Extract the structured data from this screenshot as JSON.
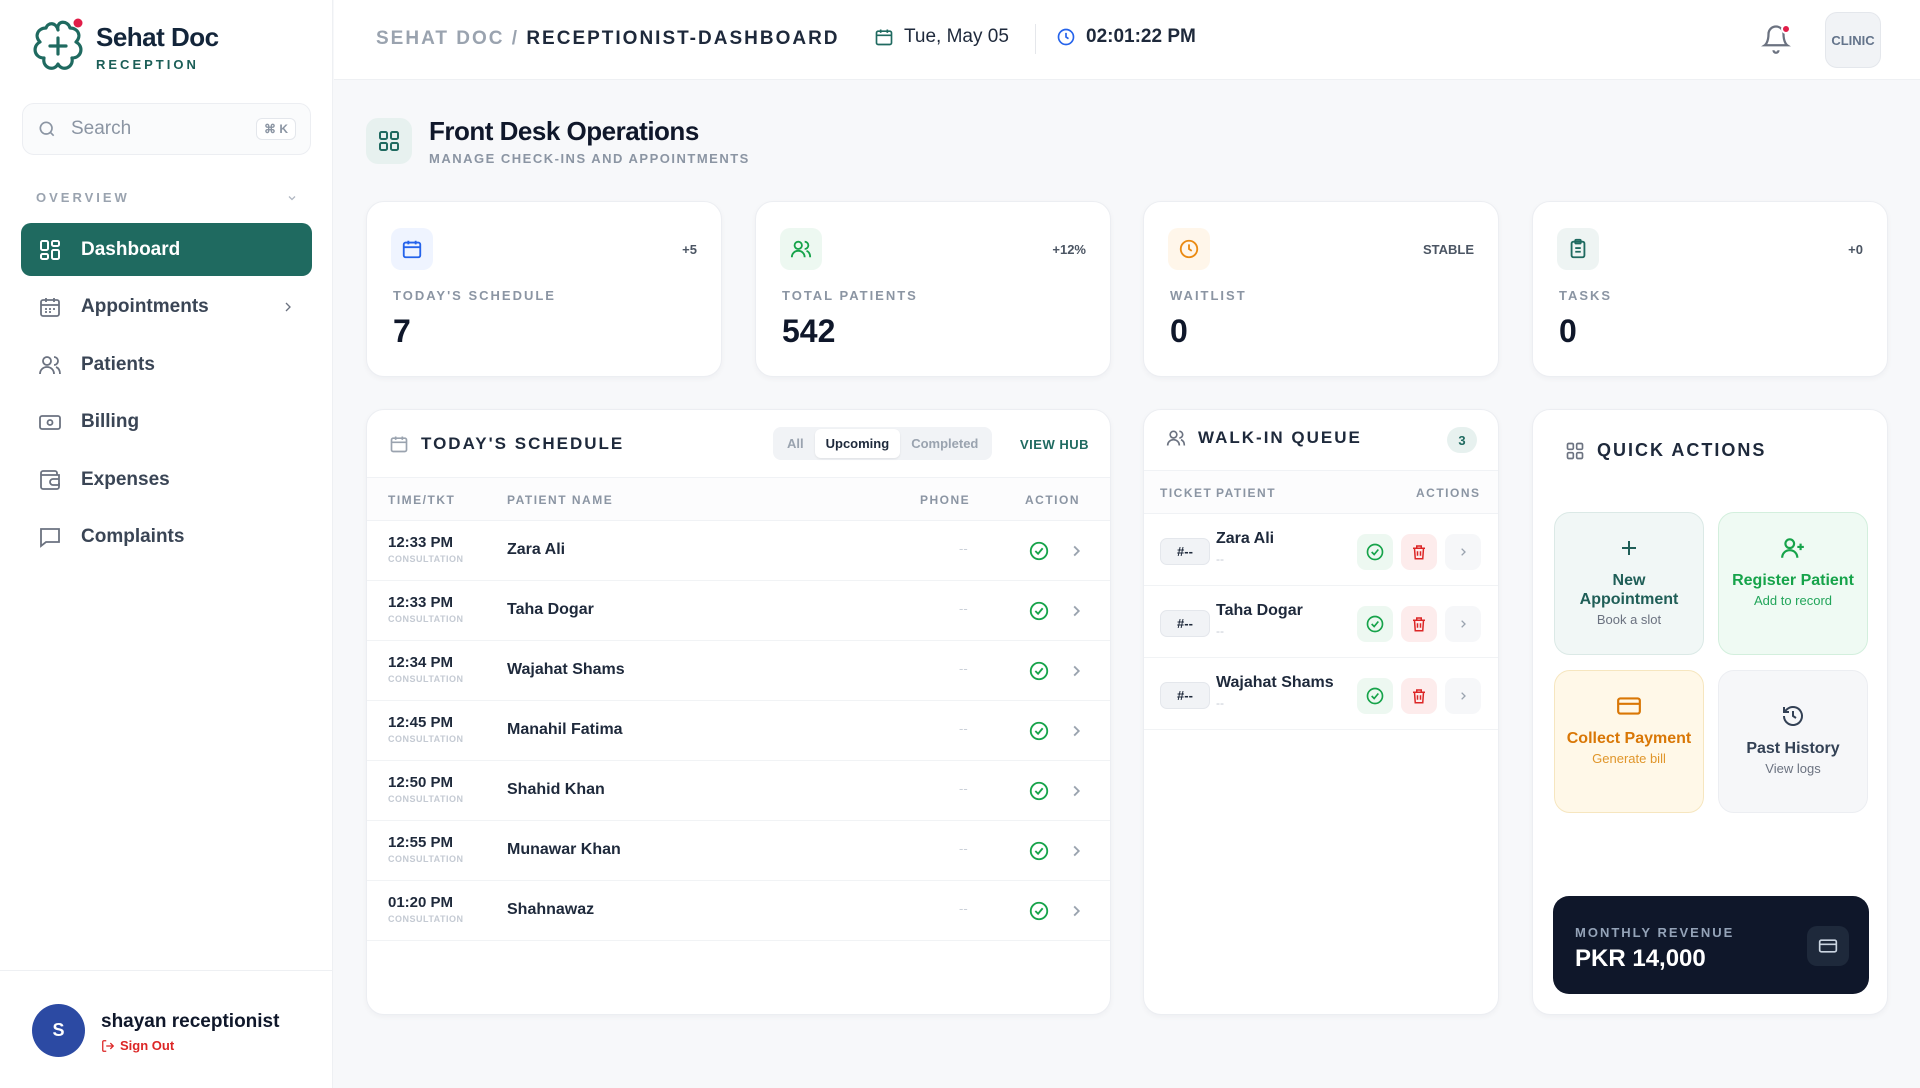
{
  "brand": {
    "name": "Sehat Doc",
    "sub": "RECEPTION"
  },
  "search": {
    "placeholder": "Search",
    "shortcut": "⌘ K"
  },
  "sidebar": {
    "section": "OVERVIEW",
    "items": [
      {
        "label": "Dashboard",
        "icon": "grid-icon",
        "active": true
      },
      {
        "label": "Appointments",
        "icon": "calendar-icon"
      },
      {
        "label": "Patients",
        "icon": "users-icon"
      },
      {
        "label": "Billing",
        "icon": "billing-icon"
      },
      {
        "label": "Expenses",
        "icon": "wallet-icon"
      },
      {
        "label": "Complaints",
        "icon": "message-icon"
      }
    ]
  },
  "user": {
    "initial": "S",
    "name": "shayan receptionist",
    "signout": "Sign Out"
  },
  "header": {
    "crumb_root": "SEHAT DOC /",
    "crumb_page": "RECEPTIONIST-DASHBOARD",
    "date": "Tue, May 05",
    "time": "02:01:22 PM",
    "clinic": "CLINIC"
  },
  "page": {
    "title": "Front Desk Operations",
    "subtitle": "MANAGE CHECK-INS AND APPOINTMENTS"
  },
  "stats": [
    {
      "label": "TODAY'S SCHEDULE",
      "value": "7",
      "badge": "+5",
      "icon": "calendar-icon",
      "color": "#2563eb",
      "bg": "#eff4ff"
    },
    {
      "label": "TOTAL PATIENTS",
      "value": "542",
      "badge": "+12%",
      "icon": "users-icon",
      "color": "#16a34a",
      "bg": "#edf8f1"
    },
    {
      "label": "WAITLIST",
      "value": "0",
      "badge": "STABLE",
      "icon": "clock-icon",
      "color": "#ea8a12",
      "bg": "#fff6ea"
    },
    {
      "label": "TASKS",
      "value": "0",
      "badge": "+0",
      "icon": "clipboard-icon",
      "color": "#1f6a60",
      "bg": "#eef4f3"
    }
  ],
  "schedule": {
    "title": "TODAY'S SCHEDULE",
    "filters": [
      "All",
      "Upcoming",
      "Completed"
    ],
    "active_filter": "Upcoming",
    "view_hub": "VIEW HUB",
    "columns": [
      "TIME/TKT",
      "PATIENT NAME",
      "PHONE",
      "ACTION"
    ],
    "rows": [
      {
        "time": "12:33 PM",
        "type": "CONSULTATION",
        "name": "Zara Ali",
        "phone": "--"
      },
      {
        "time": "12:33 PM",
        "type": "CONSULTATION",
        "name": "Taha Dogar",
        "phone": "--"
      },
      {
        "time": "12:34 PM",
        "type": "CONSULTATION",
        "name": "Wajahat Shams",
        "phone": "--"
      },
      {
        "time": "12:45 PM",
        "type": "CONSULTATION",
        "name": "Manahil Fatima",
        "phone": "--"
      },
      {
        "time": "12:50 PM",
        "type": "CONSULTATION",
        "name": "Shahid Khan",
        "phone": "--"
      },
      {
        "time": "12:55 PM",
        "type": "CONSULTATION",
        "name": "Munawar Khan",
        "phone": "--"
      },
      {
        "time": "01:20 PM",
        "type": "CONSULTATION",
        "name": "Shahnawaz",
        "phone": "--"
      }
    ]
  },
  "walkin": {
    "title": "WALK-IN QUEUE",
    "count": "3",
    "columns": [
      "TICKET",
      "PATIENT",
      "ACTIONS"
    ],
    "rows": [
      {
        "ticket": "#--",
        "name": "Zara Ali",
        "sub": "--"
      },
      {
        "ticket": "#--",
        "name": "Taha Dogar",
        "sub": "--"
      },
      {
        "ticket": "#--",
        "name": "Wajahat Shams",
        "sub": "--"
      }
    ]
  },
  "quick_actions": {
    "title": "QUICK ACTIONS",
    "tiles": [
      {
        "title": "New Appointment",
        "sub": "Book a slot",
        "icon": "plus-icon",
        "color": "#1f5e57",
        "subcolor": "#6b7280",
        "bg": "#f1f7f6",
        "border": "#dbe9e6"
      },
      {
        "title": "Register Patient",
        "sub": "Add to record",
        "icon": "user-plus-icon",
        "color": "#16a34a",
        "subcolor": "#22a55a",
        "bg": "#effaf3",
        "border": "#d3efdd"
      },
      {
        "title": "Collect Payment",
        "sub": "Generate bill",
        "icon": "card-icon",
        "color": "#d97706",
        "subcolor": "#e0962b",
        "bg": "#fff8e8",
        "border": "#f6e6bf"
      },
      {
        "title": "Past History",
        "sub": "View logs",
        "icon": "history-icon",
        "color": "#334155",
        "subcolor": "#6b7280",
        "bg": "#f6f7f9",
        "border": "#eceef2"
      }
    ],
    "revenue_label": "MONTHLY REVENUE",
    "revenue_value": "PKR 14,000"
  }
}
